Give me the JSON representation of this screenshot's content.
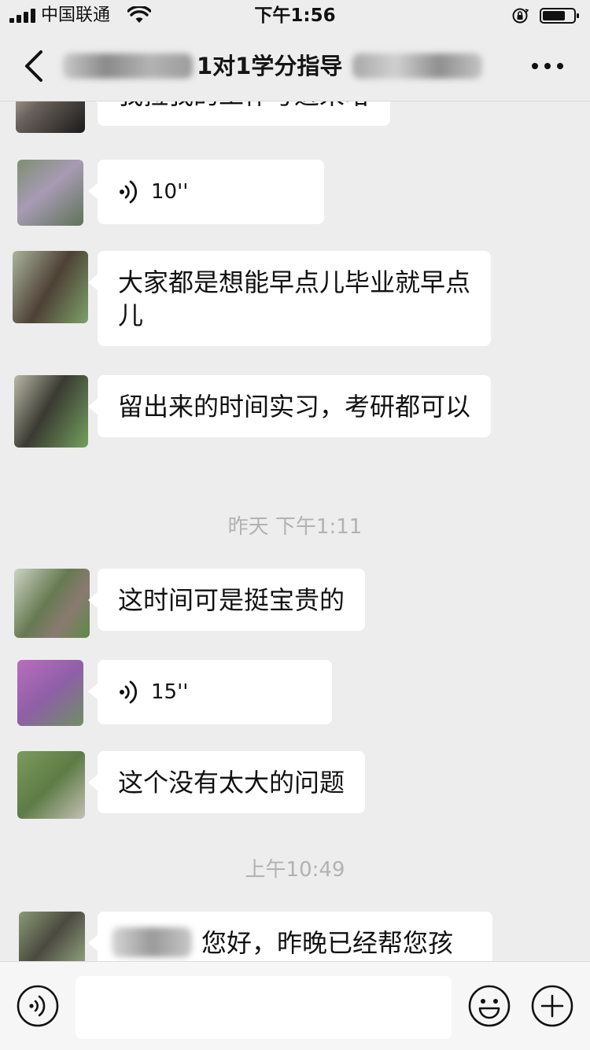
{
  "status_bar": {
    "carrier": "中国联通",
    "time": "下午1:56"
  },
  "nav": {
    "title": "1对1学分指导"
  },
  "messages": {
    "m0": {
      "text": "我拉我的工作号进来哈"
    },
    "m1": {
      "duration": "10''"
    },
    "m2": {
      "text": "大家都是想能早点儿毕业就早点儿"
    },
    "m3": {
      "text": "留出来的时间实习，考研都可以"
    },
    "t1": {
      "text": "昨天 下午1:11"
    },
    "m4": {
      "text": "这时间可是挺宝贵的"
    },
    "m5": {
      "duration": "15''"
    },
    "m6": {
      "text": "这个没有太大的问题"
    },
    "t2": {
      "text": "上午10:49"
    },
    "m7": {
      "text": "您好，昨晚已经帮您孩"
    }
  },
  "input_bar": {
    "value": "",
    "placeholder": ""
  },
  "icons": {
    "back": "chevron-left-icon",
    "more": "more-dots-icon",
    "voice": "voice-wave-icon",
    "voice_input": "voice-input-icon",
    "emoji": "emoji-smile-icon",
    "plus": "plus-icon"
  },
  "colors": {
    "background": "#ededed",
    "bubble": "#ffffff",
    "timestamp": "#b2b2b2"
  }
}
